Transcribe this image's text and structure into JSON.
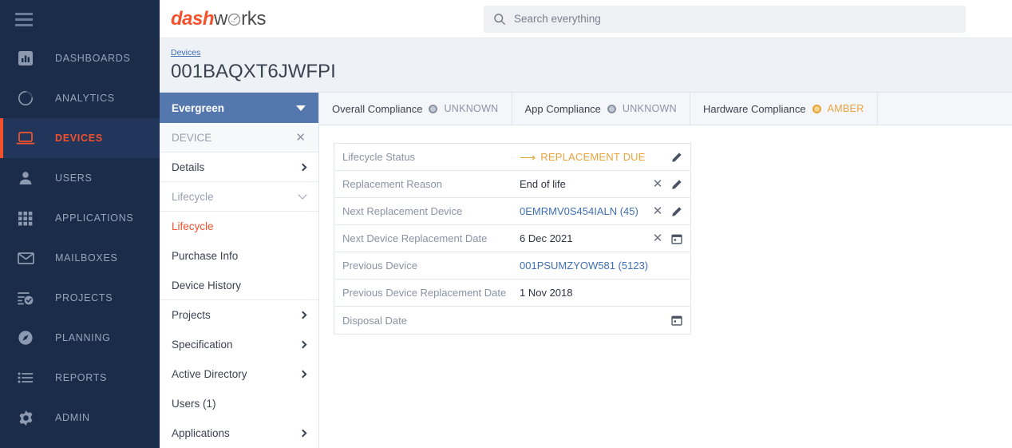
{
  "brand": {
    "logo_part1": "dash",
    "logo_part2": "w",
    "logo_icon": "gauge-icon",
    "logo_part3": "rks",
    "accent_color": "#f4512c",
    "nav_bg": "#1b2c4b"
  },
  "search": {
    "placeholder": "Search everything",
    "value": "",
    "icon": "search-icon"
  },
  "sidebar": {
    "menu_icon": "hamburger-icon",
    "items": [
      {
        "label": "DASHBOARDS",
        "icon": "bar-chart-icon",
        "active": false
      },
      {
        "label": "ANALYTICS",
        "icon": "donut-chart-icon",
        "active": false
      },
      {
        "label": "DEVICES",
        "icon": "laptop-icon",
        "active": true
      },
      {
        "label": "USERS",
        "icon": "person-icon",
        "active": false
      },
      {
        "label": "APPLICATIONS",
        "icon": "grid-apps-icon",
        "active": false
      },
      {
        "label": "MAILBOXES",
        "icon": "envelope-icon",
        "active": false
      },
      {
        "label": "PROJECTS",
        "icon": "checklist-icon",
        "active": false
      },
      {
        "label": "PLANNING",
        "icon": "compass-icon",
        "active": false
      },
      {
        "label": "REPORTS",
        "icon": "list-icon",
        "active": false
      },
      {
        "label": "ADMIN",
        "icon": "gear-icon",
        "active": false
      }
    ]
  },
  "header": {
    "breadcrumb": "Devices",
    "title": "001BAQXT6JWFPI"
  },
  "subnav": {
    "project_name": "Evergreen",
    "dropdown_icon": "caret-down-icon",
    "device_section": "DEVICE",
    "device_close_icon": "close-icon",
    "lifecycle_section": "Lifecycle",
    "lifecycle_collapse_icon": "chevron-down-icon",
    "items": [
      {
        "label": "Details",
        "chevron": true,
        "selected": false
      },
      {
        "label": "Lifecycle",
        "chevron": false,
        "selected": true
      },
      {
        "label": "Purchase Info",
        "chevron": false,
        "selected": false
      },
      {
        "label": "Device History",
        "chevron": false,
        "selected": false
      },
      {
        "label": "Projects",
        "chevron": true,
        "selected": false
      },
      {
        "label": "Specification",
        "chevron": true,
        "selected": false
      },
      {
        "label": "Active Directory",
        "chevron": true,
        "selected": false
      },
      {
        "label": "Users (1)",
        "chevron": false,
        "selected": false
      },
      {
        "label": "Applications",
        "chevron": true,
        "selected": false
      }
    ]
  },
  "tabs": [
    {
      "name": "Overall Compliance",
      "status": "UNKNOWN",
      "status_color": "#8a93a3",
      "dot": "status-dot-unknown"
    },
    {
      "name": "App Compliance",
      "status": "UNKNOWN",
      "status_color": "#8a93a3",
      "dot": "status-dot-unknown"
    },
    {
      "name": "Hardware Compliance",
      "status": "AMBER",
      "status_color": "#e8a33d",
      "dot": "status-dot-amber"
    }
  ],
  "lifecycle_table": {
    "rows": [
      {
        "key": "Lifecycle Status",
        "value": "REPLACEMENT DUE",
        "value_style": "amber",
        "prefix_icon": "arrow-right-icon",
        "actions": [
          "edit-icon"
        ]
      },
      {
        "key": "Replacement Reason",
        "value": "End of life",
        "value_style": "plain",
        "prefix_icon": "",
        "actions": [
          "clear-icon",
          "edit-icon"
        ]
      },
      {
        "key": "Next Replacement Device",
        "value": "0EMRMV0S454IALN (45)",
        "value_style": "link",
        "prefix_icon": "",
        "actions": [
          "clear-icon",
          "edit-icon"
        ]
      },
      {
        "key": "Next Device Replacement Date",
        "value": "6 Dec 2021",
        "value_style": "plain",
        "prefix_icon": "",
        "actions": [
          "clear-icon",
          "calendar-icon"
        ]
      },
      {
        "key": "Previous Device",
        "value": "001PSUMZYOW581 (5123)",
        "value_style": "link",
        "prefix_icon": "",
        "actions": []
      },
      {
        "key": "Previous Device Replacement Date",
        "value": "1 Nov 2018",
        "value_style": "plain",
        "prefix_icon": "",
        "actions": []
      },
      {
        "key": "Disposal Date",
        "value": "",
        "value_style": "plain",
        "prefix_icon": "",
        "actions": [
          "calendar-icon"
        ]
      }
    ]
  }
}
